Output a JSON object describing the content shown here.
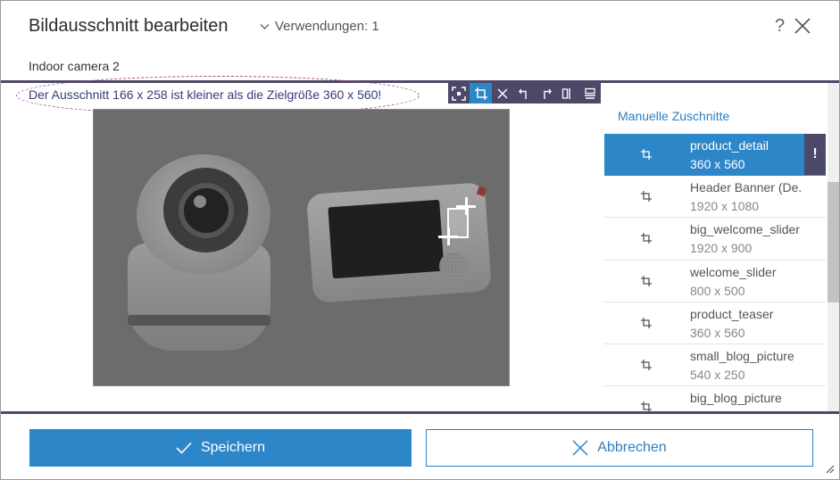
{
  "header": {
    "title": "Bildausschnitt bearbeiten",
    "usages_label": "Verwendungen: 1",
    "help_symbol": "?"
  },
  "subtitle": "Indoor camera 2",
  "warning": "Der Ausschnitt 166 x 258 ist kleiner als die Zielgröße 360 x 560!",
  "toolbar": {
    "tools": [
      "focus-icon",
      "crop-icon",
      "clear-icon",
      "rotate-left-icon",
      "rotate-right-icon",
      "flip-horizontal-icon",
      "flip-vertical-icon"
    ],
    "active_tool": "crop-icon"
  },
  "side_panel": {
    "heading": "Manuelle Zuschnitte",
    "items": [
      {
        "name": "product_detail",
        "size": "360 x 560",
        "selected": true,
        "flag": "!"
      },
      {
        "name": "Header Banner (De...",
        "size": "1920 x 1080"
      },
      {
        "name": "big_welcome_slider",
        "size": "1920 x 900"
      },
      {
        "name": "welcome_slider",
        "size": "800 x 500"
      },
      {
        "name": "product_teaser",
        "size": "360 x 560"
      },
      {
        "name": "small_blog_picture",
        "size": "540 x 250"
      },
      {
        "name": "big_blog_picture",
        "size": ""
      }
    ]
  },
  "footer": {
    "save_label": "Speichern",
    "cancel_label": "Abbrechen"
  },
  "colors": {
    "accent": "#2d86c8",
    "toolbar_bg": "#4c4868",
    "warning_text": "#3c3a78",
    "annotation_ellipse": "#b0408a"
  }
}
